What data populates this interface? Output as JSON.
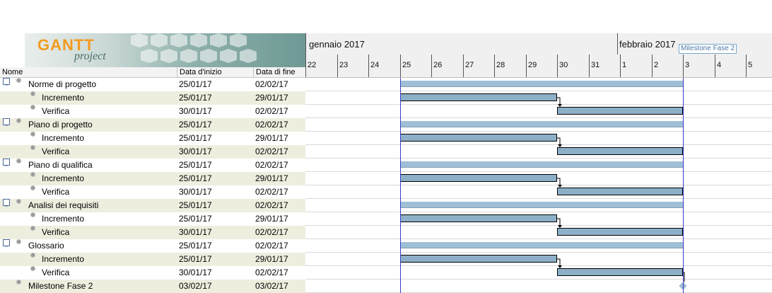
{
  "logo": {
    "brand": "GANTT",
    "sub": "project"
  },
  "table": {
    "headers": {
      "name": "Nome",
      "start": "Data d'inizio",
      "end": "Data di fine"
    },
    "rows": [
      {
        "name": "Norme di progetto",
        "start": "25/01/17",
        "end": "02/02/17",
        "level": 0
      },
      {
        "name": "Incremento",
        "start": "25/01/17",
        "end": "29/01/17",
        "level": 1
      },
      {
        "name": "Verifica",
        "start": "30/01/17",
        "end": "02/02/17",
        "level": 1
      },
      {
        "name": "Piano di progetto",
        "start": "25/01/17",
        "end": "02/02/17",
        "level": 0
      },
      {
        "name": "Incremento",
        "start": "25/01/17",
        "end": "29/01/17",
        "level": 1
      },
      {
        "name": "Verifica",
        "start": "30/01/17",
        "end": "02/02/17",
        "level": 1
      },
      {
        "name": "Piano di qualifica",
        "start": "25/01/17",
        "end": "02/02/17",
        "level": 0
      },
      {
        "name": "Incremento",
        "start": "25/01/17",
        "end": "29/01/17",
        "level": 1
      },
      {
        "name": "Verifica",
        "start": "30/01/17",
        "end": "02/02/17",
        "level": 1
      },
      {
        "name": "Analisi dei requisiti",
        "start": "25/01/17",
        "end": "02/02/17",
        "level": 0
      },
      {
        "name": "Incremento",
        "start": "25/01/17",
        "end": "29/01/17",
        "level": 1
      },
      {
        "name": "Verifica",
        "start": "30/01/17",
        "end": "02/02/17",
        "level": 1
      },
      {
        "name": "Glossario",
        "start": "25/01/17",
        "end": "02/02/17",
        "level": 0
      },
      {
        "name": "Incremento",
        "start": "25/01/17",
        "end": "29/01/17",
        "level": 1
      },
      {
        "name": "Verifica",
        "start": "30/01/17",
        "end": "02/02/17",
        "level": 1
      },
      {
        "name": "Milestone Fase 2",
        "start": "03/02/17",
        "end": "03/02/17",
        "level": 0
      }
    ]
  },
  "chart": {
    "months": [
      "gennaio 2017",
      "febbraio 2017"
    ],
    "days": [
      "22",
      "23",
      "24",
      "25",
      "26",
      "27",
      "28",
      "29",
      "30",
      "31",
      "1",
      "2",
      "3",
      "4",
      "5"
    ],
    "milestone_label": "Milestone Fase 2",
    "expander_symbol": "−",
    "colors": {
      "task": "#8db0c8",
      "summary": "#9fbfd6",
      "today": "#3a3ac8",
      "milestone": "#9fbfd6"
    }
  }
}
